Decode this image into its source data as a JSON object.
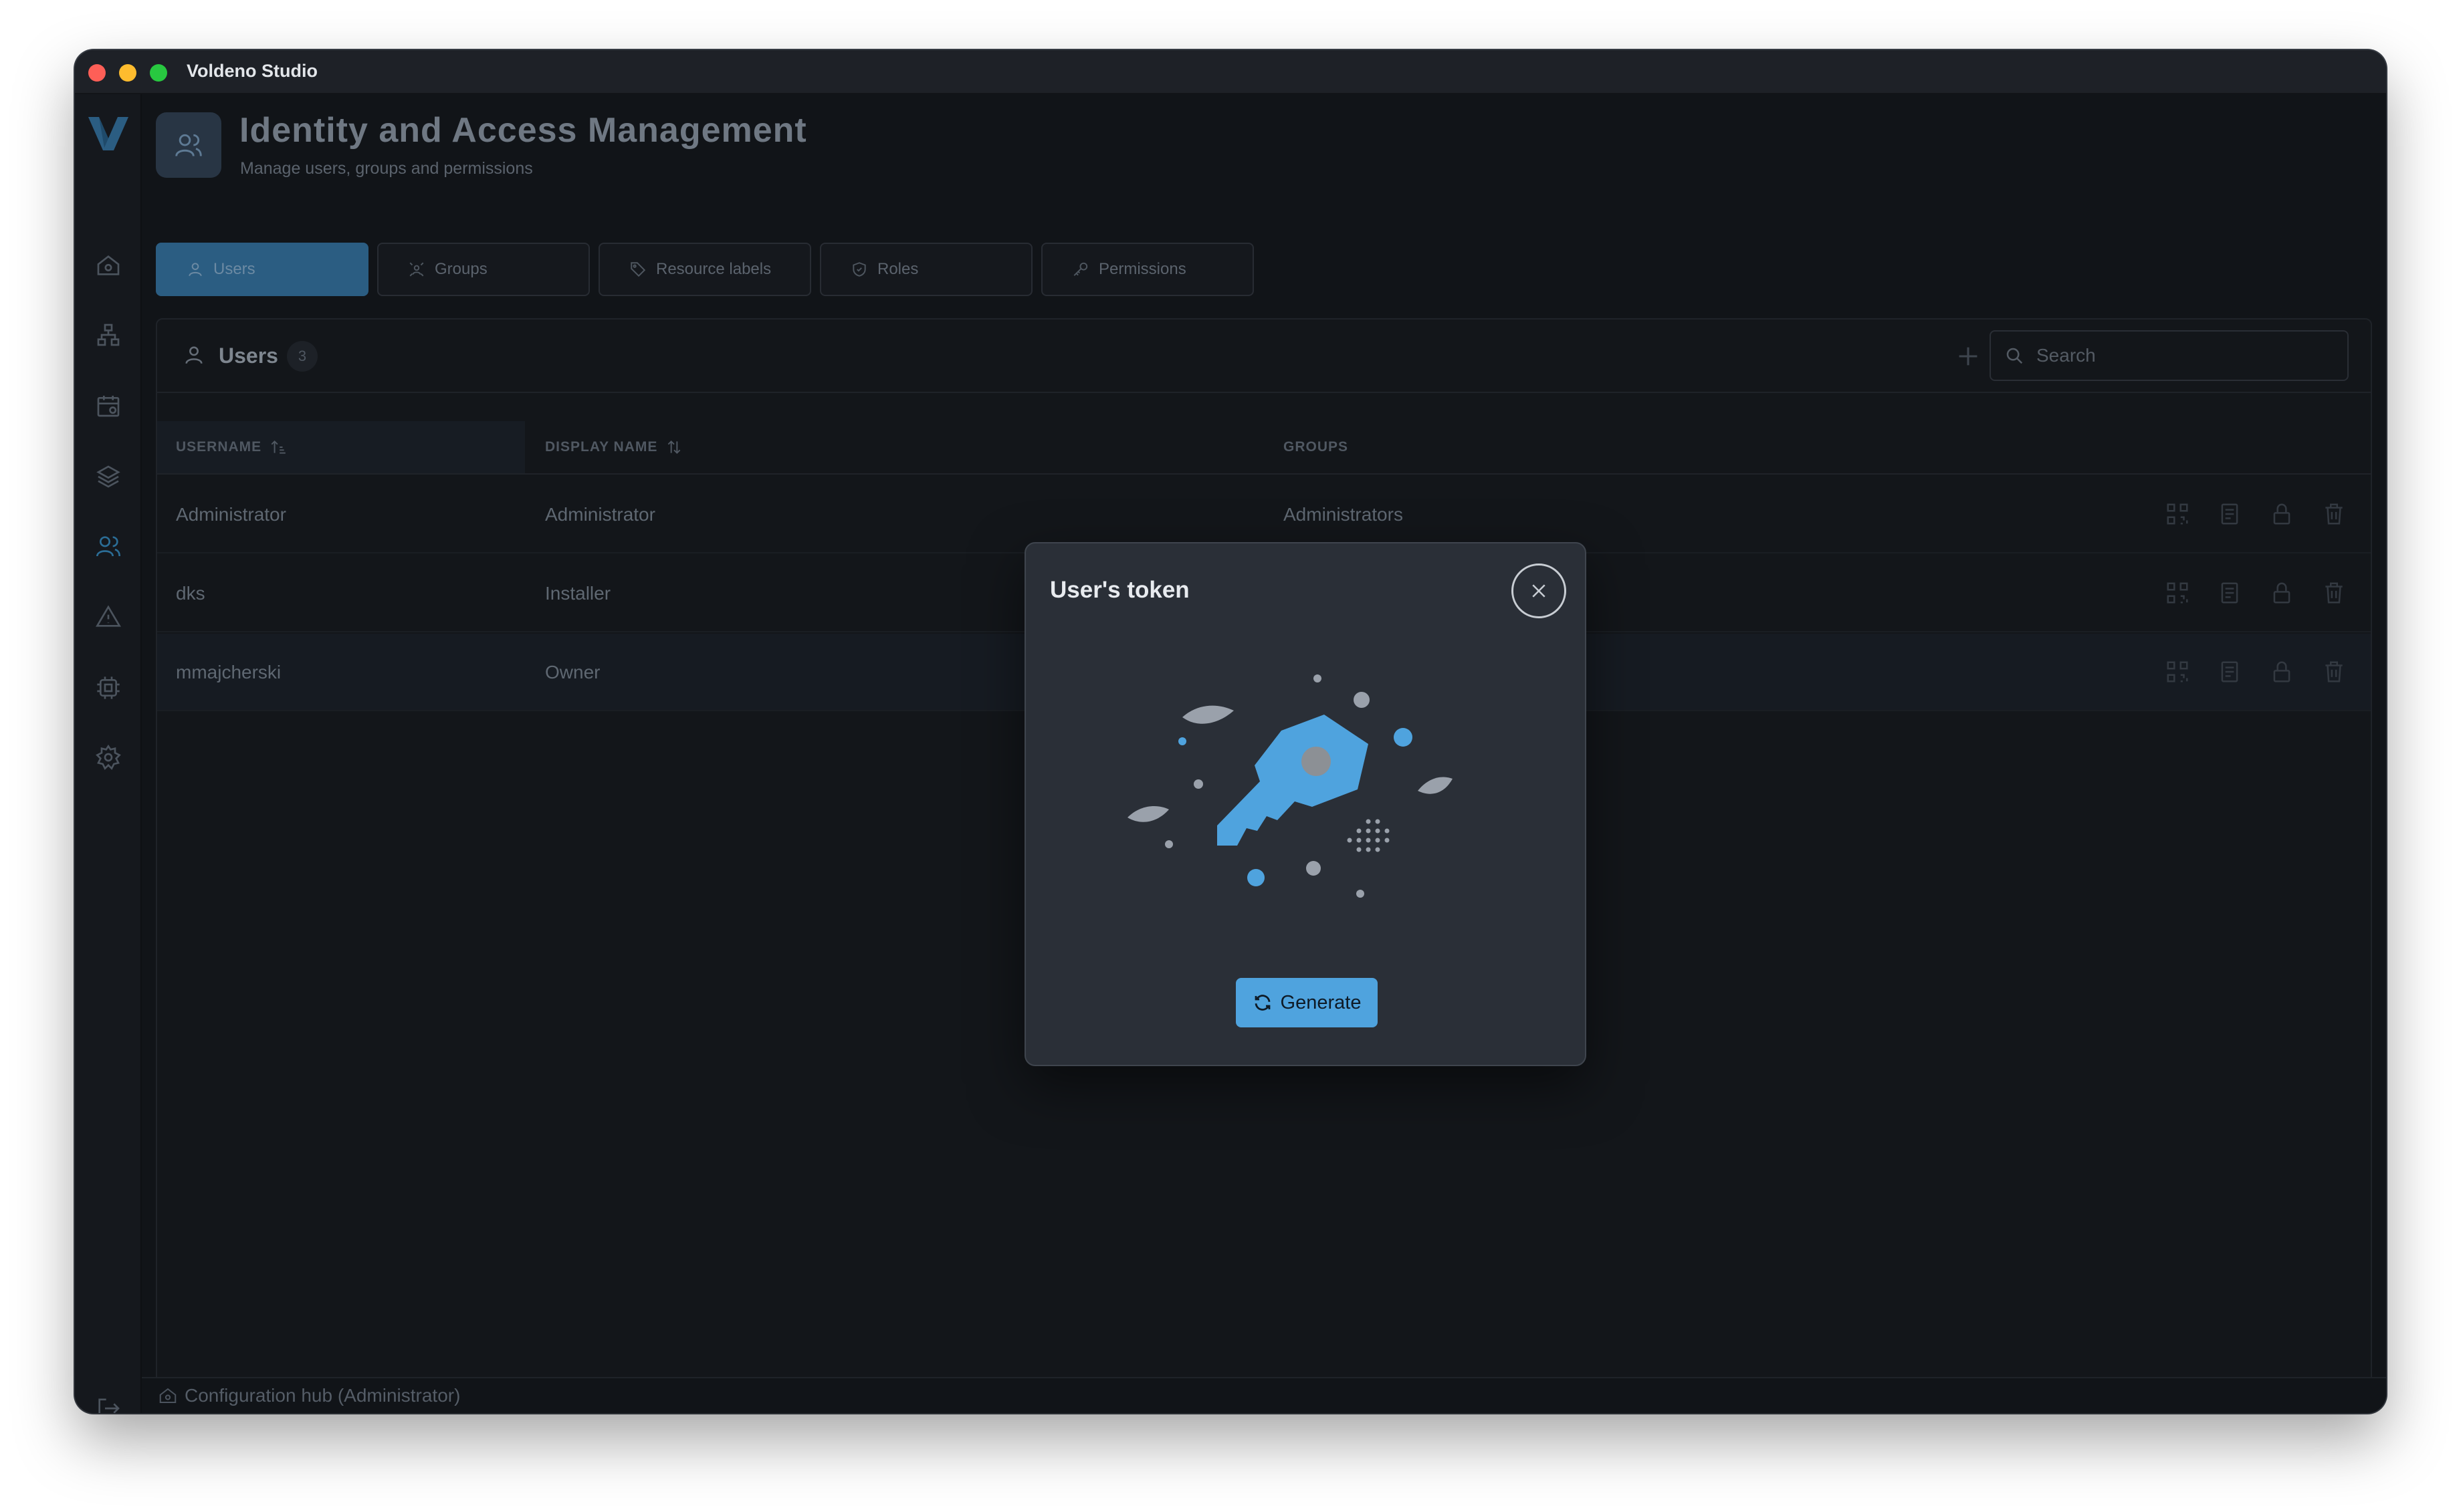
{
  "window": {
    "title": "Voldeno Studio"
  },
  "header": {
    "title": "Identity and Access Management",
    "subtitle": "Manage users, groups and permissions"
  },
  "tabs": [
    {
      "label": "Users",
      "icon": "user-icon",
      "active": true
    },
    {
      "label": "Groups",
      "icon": "groups-icon",
      "active": false
    },
    {
      "label": "Resource labels",
      "icon": "tag-icon",
      "active": false
    },
    {
      "label": "Roles",
      "icon": "shield-icon",
      "active": false
    },
    {
      "label": "Permissions",
      "icon": "key-icon",
      "active": false
    }
  ],
  "panel": {
    "title": "Users",
    "count": "3",
    "search_placeholder": "Search"
  },
  "table": {
    "columns": [
      "USERNAME",
      "DISPLAY NAME",
      "GROUPS"
    ],
    "rows": [
      {
        "username": "Administrator",
        "display_name": "Administrator",
        "groups": "Administrators"
      },
      {
        "username": "dks",
        "display_name": "Installer",
        "groups": ""
      },
      {
        "username": "mmajcherski",
        "display_name": "Owner",
        "groups": ""
      }
    ]
  },
  "footer": {
    "label": "Configuration hub (Administrator)"
  },
  "modal": {
    "title": "User's token",
    "generate_label": "Generate"
  },
  "colors": {
    "accent": "#4fa3de",
    "active_tab": "#2b5d82",
    "background": "#111418"
  }
}
